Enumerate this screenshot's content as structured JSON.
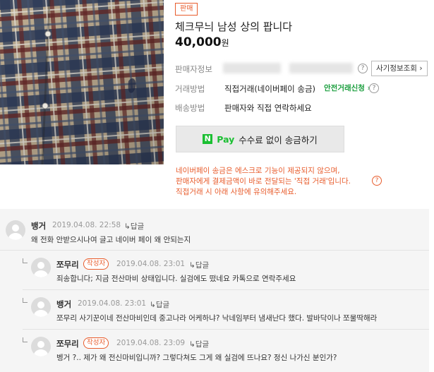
{
  "product": {
    "badge": "판매",
    "title": "체크무늬 남성 상의 팝니다",
    "price": "40,000",
    "price_unit": "원"
  },
  "details": {
    "seller_label": "판매자정보",
    "fraud_check_button": "사기정보조회",
    "trade_label": "거래방법",
    "trade_value": "직접거래(네이버페이 송금)",
    "safe_trade_link": "안전거래신청",
    "shipping_label": "배송방법",
    "shipping_value": "판매자와 직접 연락하세요"
  },
  "npay": {
    "n": "N",
    "pay": "Pay",
    "label": "수수료 없이 송금하기"
  },
  "notice": [
    "네이버페이 송금은 에스크로 기능이 제공되지 않으며,",
    "판매자에게 결제금액이 바로 전달되는 '직접 거래'입니다.",
    "직접거래 시 아래 사항에 유의해주세요."
  ],
  "comments": [
    {
      "nick": "뱅거",
      "date": "2019.04.08. 22:58",
      "reply": "답글",
      "text": "왜 전화 안받으시나여 글고 네이버 페이 왜 안되는지",
      "writer": ""
    },
    {
      "nick": "쪼무리",
      "date": "2019.04.08. 23:01",
      "reply": "답글",
      "text": "죄송합니다; 지금 전산마비 상태입니다. 실검에도 떴네요 카톡으로 연락주세요",
      "writer": "작성자"
    },
    {
      "nick": "뱅거",
      "date": "2019.04.08. 23:01",
      "reply": "답글",
      "text": "쪼무리 사기꾼이네 전산마비인데 중고나라 어케하냐? 낙네임부터 냄새난다 했다. 발바닥이나 쪼물딱해라",
      "writer": ""
    },
    {
      "nick": "쪼무리",
      "date": "2019.04.08. 23:09",
      "reply": "답글",
      "text": "벵거 ?.. 제가 왜 전신마비입니까? 그렇다쳐도 그게 왜 실검에 뜨나요? 정신 나가신 분인가?",
      "writer": "작성자"
    }
  ],
  "colors": {
    "accent_orange": "#e85c2c",
    "naver_green": "#1bbf32",
    "safe_green": "#1a9e3d"
  }
}
